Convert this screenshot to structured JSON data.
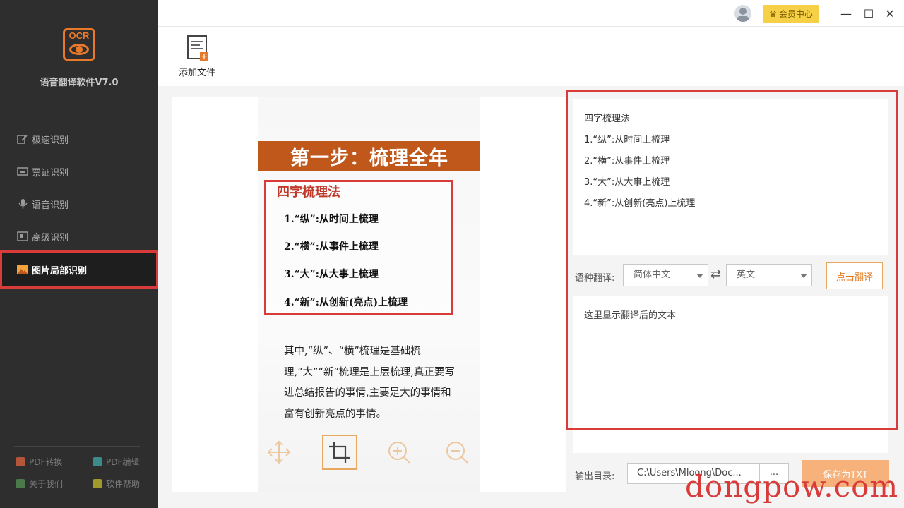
{
  "app": {
    "logo_text": "OCR",
    "name": "语音翻译软件V7.0"
  },
  "sidebar": {
    "items": [
      {
        "label": "极速识别",
        "active": false
      },
      {
        "label": "票证识别",
        "active": false
      },
      {
        "label": "语音识别",
        "active": false
      },
      {
        "label": "高级识别",
        "active": false
      },
      {
        "label": "图片局部识别",
        "active": true
      }
    ],
    "footer": {
      "pdf_convert": "PDF转换",
      "pdf_edit": "PDF编辑",
      "about": "关于我们",
      "help": "软件帮助"
    }
  },
  "titlebar": {
    "vip_label": "会员中心",
    "minimize": "—",
    "maximize": "☐",
    "close": "✕"
  },
  "toolbar": {
    "add_file_label": "添加文件"
  },
  "preview": {
    "header": "第一步：梳理全年",
    "box_title": "四字梳理法",
    "lines": [
      "1.“纵”:从时间上梳理",
      "2.“横”:从事件上梳理",
      "3.“大”:从大事上梳理",
      "4.“新”:从创新(亮点)上梳理"
    ],
    "paragraph": "其中,“纵”、“横”梳理是基础梳理,“大”“新”梳理是上层梳理,真正要写进总结报告的事情,主要是大的事情和富有创新亮点的事情。"
  },
  "result": {
    "lines": [
      "四字梳理法",
      "1.“纵”:从时间上梳理",
      "2.“横”:从事件上梳理",
      "3.“大”:从大事上梳理",
      "4.“新”:从创新(亮点)上梳理"
    ]
  },
  "translate": {
    "label": "语种翻译:",
    "source_lang": "简体中文",
    "target_lang": "英文",
    "button": "点击翻译",
    "placeholder": "这里显示翻译后的文本"
  },
  "output": {
    "label": "输出目录:",
    "path": "C:\\Users\\Mloong\\Doc...",
    "browse": "...",
    "save_button": "保存为TXT"
  },
  "watermark": "dongpow.com",
  "colors": {
    "accent": "#e8782a",
    "highlight_red": "#d93b3b",
    "sidebar_bg": "#2e2e2e",
    "doc_header": "#c0571b"
  }
}
